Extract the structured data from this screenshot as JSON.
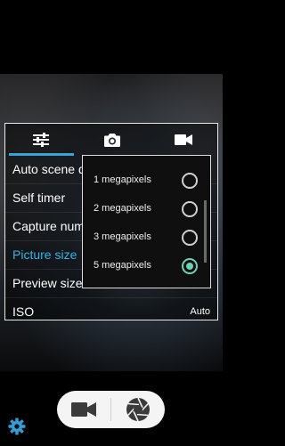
{
  "settings_tabs": [
    {
      "icon": "sliders-icon"
    },
    {
      "icon": "camera-icon"
    },
    {
      "icon": "video-camera-icon"
    }
  ],
  "settings": [
    {
      "label": "Auto scene d",
      "value": ""
    },
    {
      "label": "Self timer",
      "value": ""
    },
    {
      "label": "Capture num",
      "value": ""
    },
    {
      "label": "Picture size",
      "value": "",
      "active": true
    },
    {
      "label": "Preview size",
      "value": ""
    },
    {
      "label": "ISO",
      "value": "Auto"
    }
  ],
  "picture_size_options": [
    {
      "label": "1 megapixels",
      "selected": false
    },
    {
      "label": "2 megapixels",
      "selected": false
    },
    {
      "label": "3 megapixels",
      "selected": false
    },
    {
      "label": "5 megapixels",
      "selected": true
    }
  ],
  "controls": {
    "left": "video-camera-icon",
    "right": "shutter-icon",
    "settings": "gear-icon"
  },
  "colors": {
    "accent": "#33b5e5",
    "radio_selected": "#6fd0b4",
    "gear": "#2fa0d8"
  }
}
